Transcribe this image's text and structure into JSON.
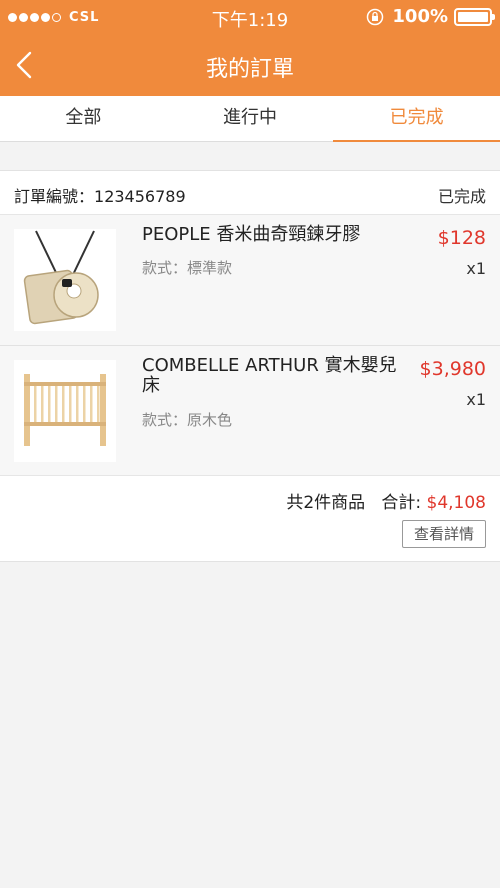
{
  "status_bar": {
    "carrier": "CSL",
    "time": "下午1:19",
    "battery": "100%"
  },
  "nav": {
    "title": "我的訂單",
    "back_icon": "chevron-left-icon"
  },
  "tabs": [
    {
      "label": "全部",
      "active": false
    },
    {
      "label": "進行中",
      "active": false
    },
    {
      "label": "已完成",
      "active": true
    }
  ],
  "order": {
    "number_label": "訂單編號：",
    "number": "123456789",
    "status": "已完成",
    "items": [
      {
        "name": "PEOPLE 香米曲奇頸鍊牙膠",
        "variant_label": "款式：",
        "variant": "標準款",
        "price": "$128",
        "qty": "x1"
      },
      {
        "name": "COMBELLE ARTHUR 實木嬰兒床",
        "variant_label": "款式：",
        "variant": "原木色",
        "price": "$3,980",
        "qty": "x1"
      }
    ],
    "count_text": "共2件商品",
    "total_label": "合計:",
    "total": "$4,108",
    "detail_button": "查看詳情"
  },
  "colors": {
    "brand": "#f08a3c",
    "price": "#e0372c"
  }
}
